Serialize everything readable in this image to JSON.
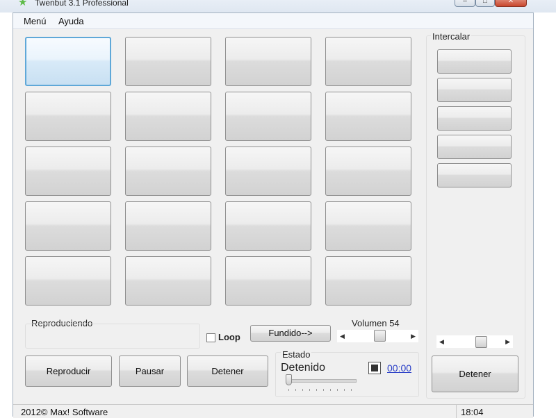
{
  "window": {
    "title": "Twenbut 3.1 Professional",
    "app_icon": "star-icon",
    "min_label": "–",
    "max_label": "□",
    "close_label": "✕"
  },
  "menu": [
    {
      "label": "Menú"
    },
    {
      "label": "Ayuda"
    }
  ],
  "pad_grid": {
    "rows": 5,
    "columns": 4,
    "selected_index": 0
  },
  "intercalar": {
    "label": "Intercalar",
    "button_count": 5,
    "stop_label": "Detener",
    "slider_level": 0.67
  },
  "reproduciendo": {
    "label": "Reproduciendo"
  },
  "loop": {
    "label": "Loop",
    "checked": false
  },
  "fade_button": {
    "label": "Fundido-->"
  },
  "volume": {
    "label": "Volumen 54",
    "value": 54
  },
  "transport": {
    "play_label": "Reproducir",
    "pause_label": "Pausar",
    "stop_label": "Detener"
  },
  "estado": {
    "label": "Estado",
    "value": "Detenido",
    "time": "00:00",
    "position": 0
  },
  "status_bar": {
    "copyright": "2012© Max! Software",
    "clock": "18:04"
  }
}
